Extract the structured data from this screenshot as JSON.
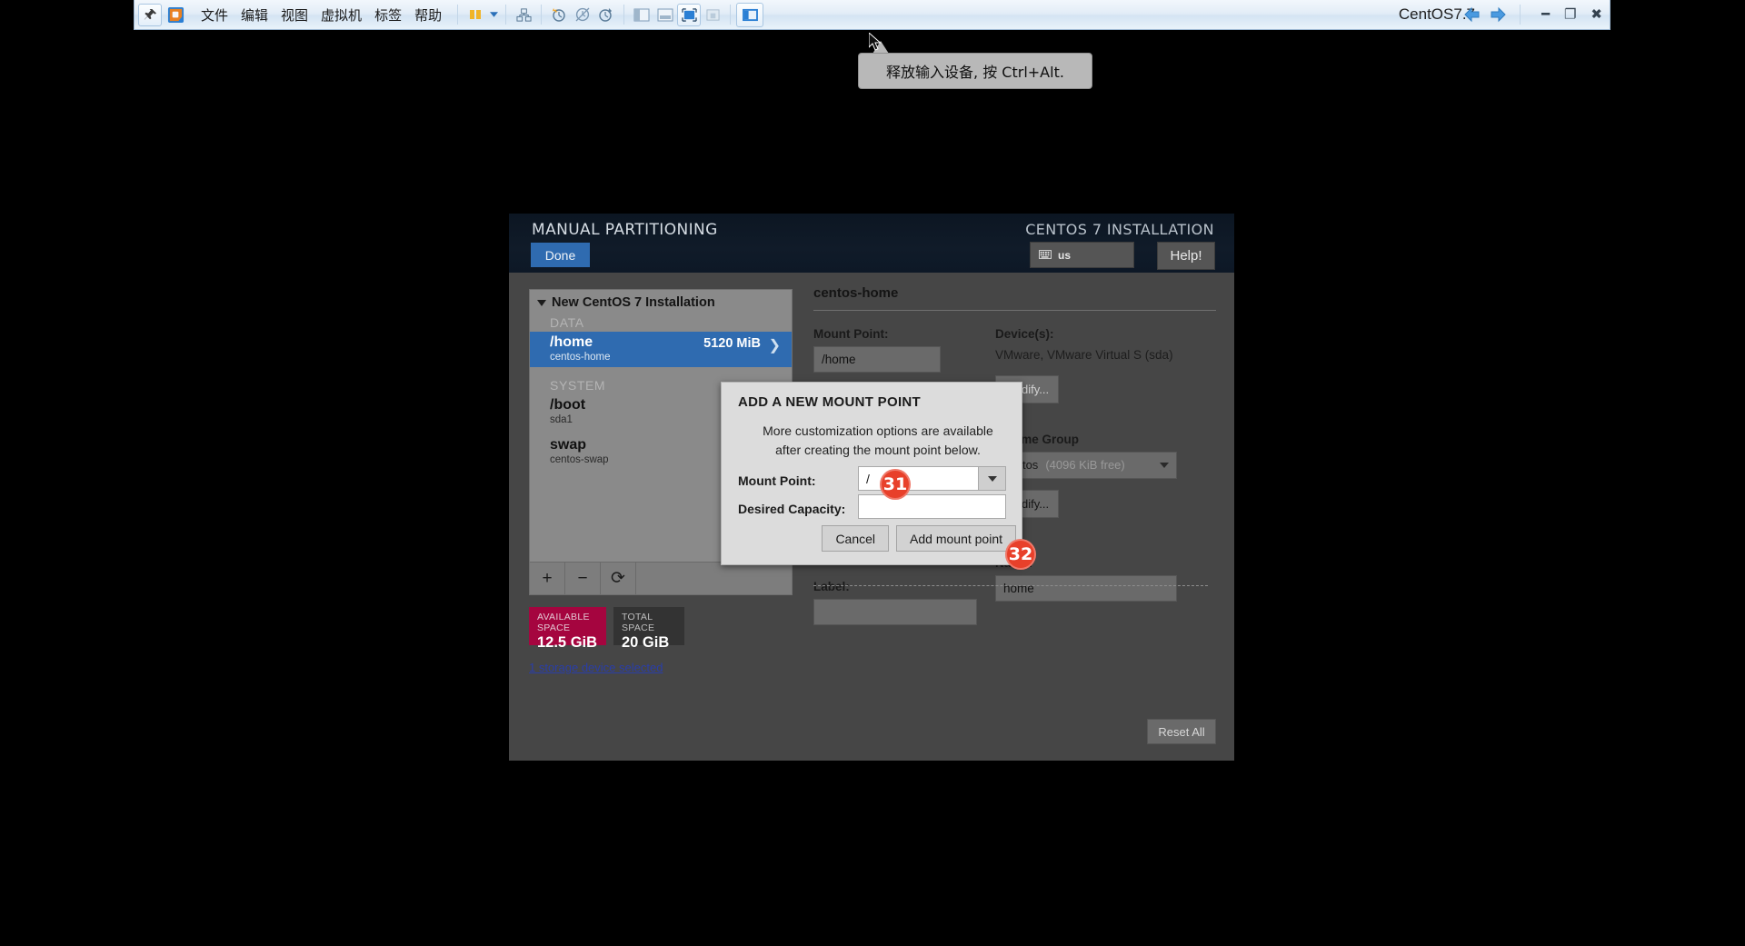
{
  "vmware": {
    "title": "CentOS7.7",
    "menus": [
      "文件",
      "编辑",
      "视图",
      "虚拟机",
      "标签",
      "帮助"
    ],
    "toolbar_icons": [
      "pin-icon",
      "vmware-logo-icon",
      "library-icon",
      "chevron-down-icon",
      "snapshot-manager-icon",
      "take-snapshot-icon",
      "revert-snapshot-icon",
      "manage-snapshots-icon",
      "show-library-icon",
      "show-thumbnails-icon",
      "fullscreen-icon",
      "unity-mode-icon",
      "console-view-icon"
    ],
    "nav_icons": [
      "back-arrow-icon",
      "forward-arrow-icon"
    ],
    "window_controls": [
      "minimize",
      "restore",
      "close"
    ]
  },
  "tooltip": {
    "text": "释放输入设备, 按 Ctrl+Alt."
  },
  "installer": {
    "screen_title": "MANUAL PARTITIONING",
    "brand": "CENTOS 7 INSTALLATION",
    "done_label": "Done",
    "keyboard_layout": "us",
    "keyboard_icon": "keyboard-icon",
    "help_label": "Help!",
    "partition_tree": {
      "root_label": "New CentOS 7 Installation",
      "groups": [
        {
          "name": "DATA",
          "rows": [
            {
              "mount": "/home",
              "device": "centos-home",
              "size": "5120 MiB",
              "selected": true
            }
          ]
        },
        {
          "name": "SYSTEM",
          "rows": [
            {
              "mount": "/boot",
              "device": "sda1",
              "size": "",
              "selected": false
            },
            {
              "mount": "swap",
              "device": "centos-swap",
              "size": "",
              "selected": false
            }
          ]
        }
      ],
      "toolbar": [
        {
          "icon": "plus-icon",
          "glyph": "+"
        },
        {
          "icon": "minus-icon",
          "glyph": "−"
        },
        {
          "icon": "refresh-icon",
          "glyph": "⟳"
        }
      ]
    },
    "space": {
      "available_caption": "AVAILABLE SPACE",
      "available_value": "12.5 GiB",
      "total_caption": "TOTAL SPACE",
      "total_value": "20 GiB",
      "available_color": "#a5053f",
      "total_color": "#333333"
    },
    "storage_link": "1 storage device selected",
    "reset_all_label": "Reset All",
    "detail": {
      "title": "centos-home",
      "mount_point_label": "Mount Point:",
      "mount_point_value": "/home",
      "devices_label": "Device(s):",
      "devices_value": "VMware, VMware Virtual S (sda)",
      "devices_modify_label": "Modify...",
      "volume_group_label": "Volume Group",
      "volume_group_value": "centos",
      "volume_group_free": "(4096 KiB free)",
      "volume_group_modify_label": "Modify...",
      "label_label": "Label:",
      "label_value": "",
      "name_label": "Name:",
      "name_value": "home"
    }
  },
  "modal": {
    "title": "ADD A NEW MOUNT POINT",
    "description": "More customization options are available after creating the mount point below.",
    "mount_point_label": "Mount Point:",
    "mount_point_value": "/",
    "desired_capacity_label": "Desired Capacity:",
    "desired_capacity_value": "",
    "cancel_label": "Cancel",
    "add_label": "Add mount point"
  },
  "badges": [
    {
      "id": "31",
      "label": "31",
      "color": "#e8402a"
    },
    {
      "id": "32",
      "label": "32",
      "color": "#e8402a"
    }
  ]
}
